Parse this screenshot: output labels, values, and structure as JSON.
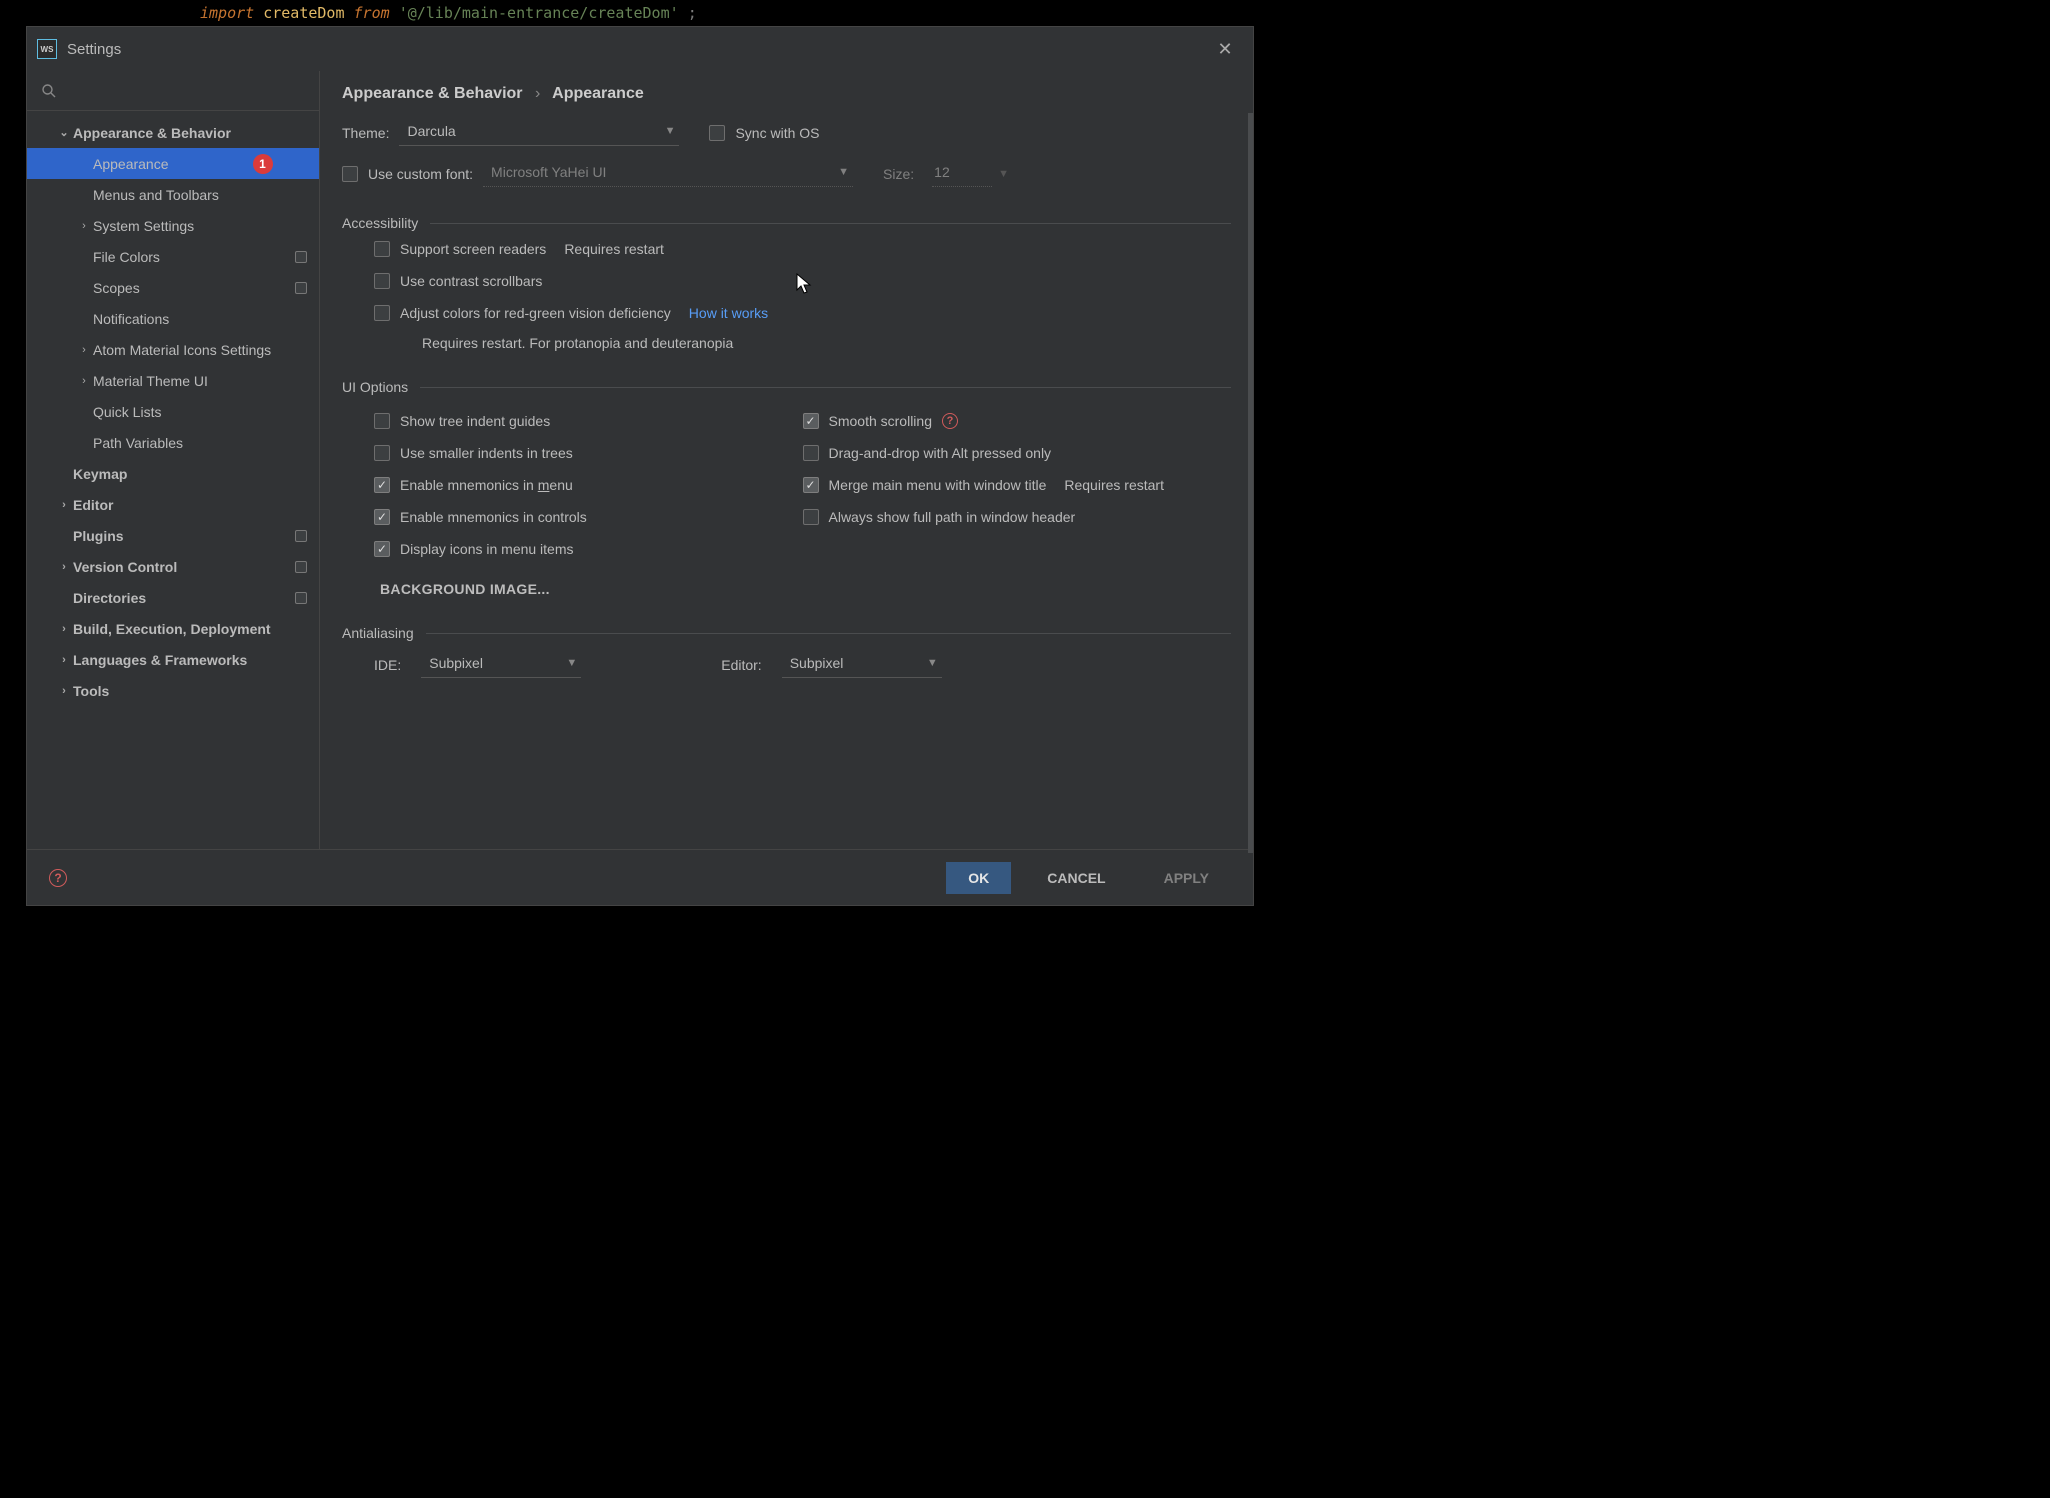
{
  "code_strip": {
    "kw1": "import",
    "id": "createDom",
    "kw2": "from",
    "str": "'@/lib/main-entrance/createDom'",
    "semi": ";"
  },
  "dialog": {
    "title": "Settings",
    "logo": "WS"
  },
  "tree": {
    "appearance_behavior": "Appearance & Behavior",
    "appearance": "Appearance",
    "appearance_badge": "1",
    "menus_toolbars": "Menus and Toolbars",
    "system_settings": "System Settings",
    "file_colors": "File Colors",
    "scopes": "Scopes",
    "notifications": "Notifications",
    "atom_icons": "Atom Material Icons Settings",
    "material_theme": "Material Theme UI",
    "quick_lists": "Quick Lists",
    "path_variables": "Path Variables",
    "keymap": "Keymap",
    "editor": "Editor",
    "plugins": "Plugins",
    "version_control": "Version Control",
    "directories": "Directories",
    "build": "Build, Execution, Deployment",
    "languages": "Languages & Frameworks",
    "tools": "Tools"
  },
  "breadcrumb": {
    "a": "Appearance & Behavior",
    "b": "Appearance"
  },
  "theme": {
    "label": "Theme:",
    "value": "Darcula",
    "sync": "Sync with OS"
  },
  "font": {
    "use_custom": "Use custom font:",
    "value": "Microsoft YaHei UI",
    "size_label": "Size:",
    "size_value": "12"
  },
  "accessibility": {
    "title": "Accessibility",
    "screen_readers": "Support screen readers",
    "requires_restart": "Requires restart",
    "contrast_scrollbars": "Use contrast scrollbars",
    "adjust_colors": "Adjust colors for red-green vision deficiency",
    "how_it_works": "How it works",
    "note": "Requires restart. For protanopia and deuteranopia"
  },
  "ui_options": {
    "title": "UI Options",
    "tree_indent": "Show tree indent guides",
    "smaller_indents": "Use smaller indents in trees",
    "mnemonics_menu_a": "Enable mnemonics in ",
    "mnemonics_menu_b": "m",
    "mnemonics_menu_c": "enu",
    "mnemonics_controls": "Enable mnemonics in controls",
    "display_icons": "Display icons in menu items",
    "smooth_scrolling": "Smooth scrolling",
    "drag_alt": "Drag-and-drop with Alt pressed only",
    "merge_menu": "Merge main menu with window title",
    "merge_hint": "Requires restart",
    "full_path": "Always show full path in window header",
    "bg_image": "BACKGROUND IMAGE..."
  },
  "antialiasing": {
    "title": "Antialiasing",
    "ide_label": "IDE:",
    "ide_value": "Subpixel",
    "editor_label": "Editor:",
    "editor_value": "Subpixel"
  },
  "footer": {
    "ok": "OK",
    "cancel": "CANCEL",
    "apply": "APPLY"
  }
}
